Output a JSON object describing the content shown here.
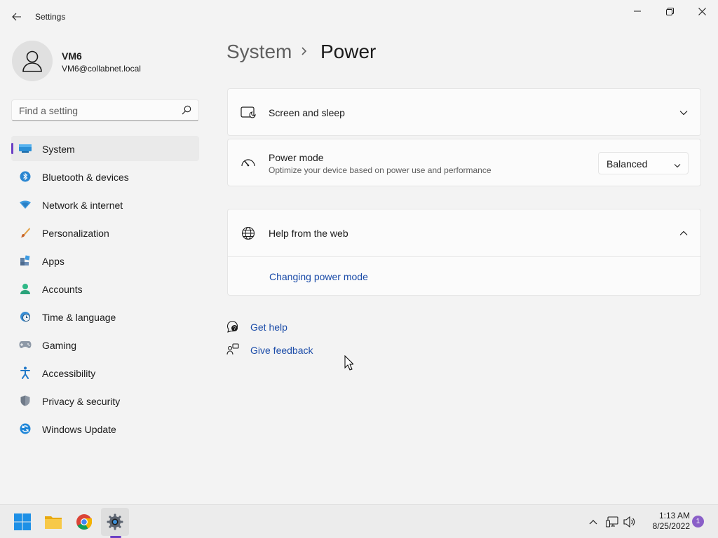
{
  "window": {
    "app_title": "Settings",
    "controls": [
      "minimize-icon",
      "restore-icon",
      "close-icon"
    ]
  },
  "user": {
    "name": "VM6",
    "email": "VM6@collabnet.local"
  },
  "search": {
    "placeholder": "Find a setting"
  },
  "sidebar": {
    "items": [
      {
        "label": "System",
        "icon": "system-icon",
        "selected": true
      },
      {
        "label": "Bluetooth & devices",
        "icon": "bluetooth-icon"
      },
      {
        "label": "Network & internet",
        "icon": "network-icon"
      },
      {
        "label": "Personalization",
        "icon": "brush-icon"
      },
      {
        "label": "Apps",
        "icon": "apps-icon"
      },
      {
        "label": "Accounts",
        "icon": "accounts-icon"
      },
      {
        "label": "Time & language",
        "icon": "clock-globe-icon"
      },
      {
        "label": "Gaming",
        "icon": "gamepad-icon"
      },
      {
        "label": "Accessibility",
        "icon": "accessibility-icon"
      },
      {
        "label": "Privacy & security",
        "icon": "shield-icon"
      },
      {
        "label": "Windows Update",
        "icon": "update-icon"
      }
    ]
  },
  "breadcrumb": {
    "parent": "System",
    "current": "Power"
  },
  "cards": {
    "screen_sleep": {
      "title": "Screen and sleep"
    },
    "power_mode": {
      "title": "Power mode",
      "subtitle": "Optimize your device based on power use and performance",
      "selected": "Balanced"
    },
    "help": {
      "title": "Help from the web",
      "link": "Changing power mode"
    }
  },
  "links": {
    "get_help": "Get help",
    "give_feedback": "Give feedback"
  },
  "taskbar": {
    "apps": [
      "start-icon",
      "file-explorer-icon",
      "chrome-icon",
      "settings-icon"
    ],
    "time": "1:13 AM",
    "date": "8/25/2022",
    "notification_count": "1"
  },
  "colors": {
    "accent": "#6b3fc4",
    "link": "#1a4ba8"
  }
}
